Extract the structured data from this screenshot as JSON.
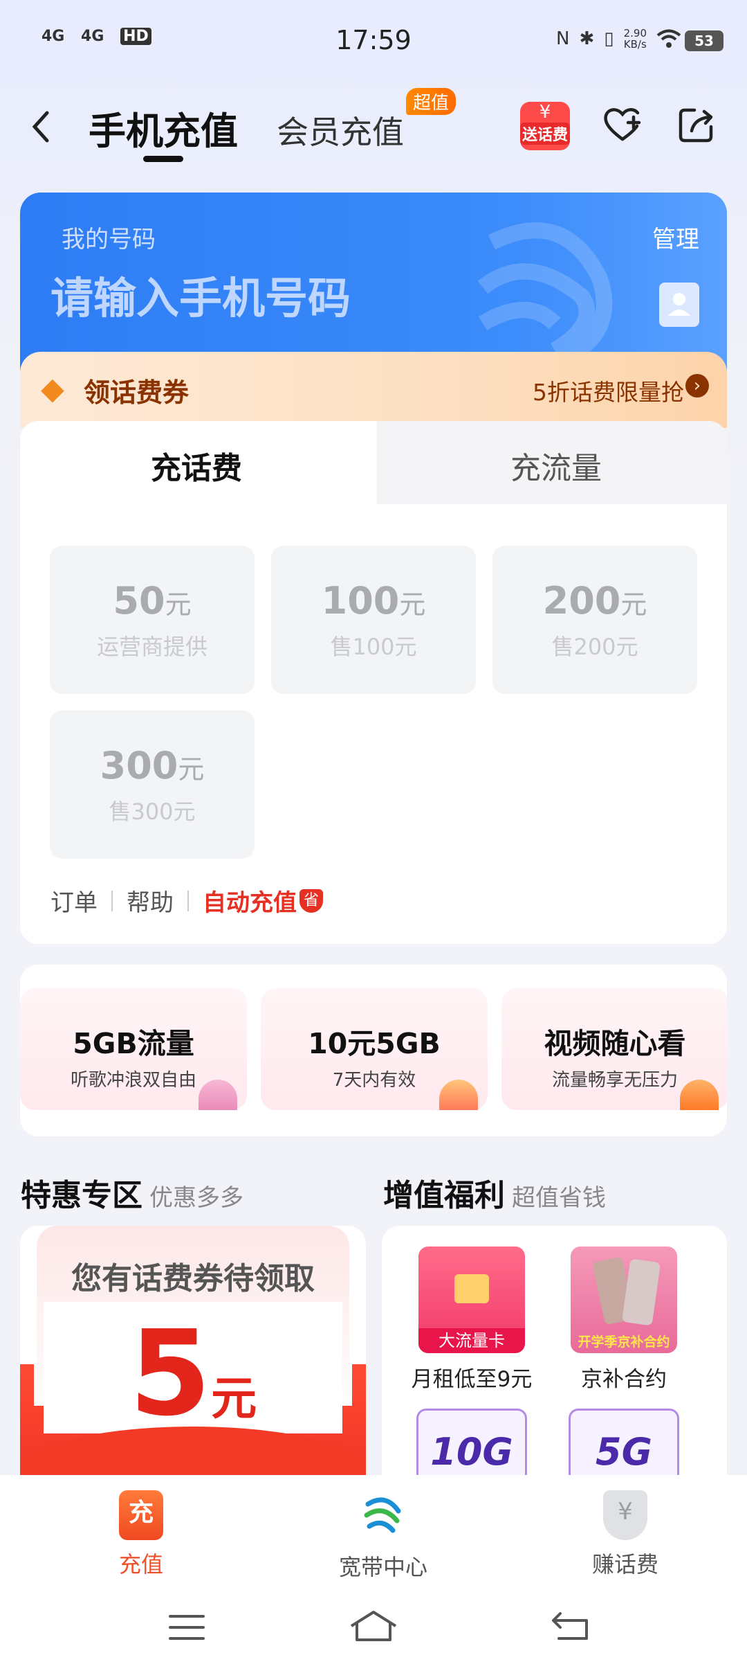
{
  "status_bar": {
    "signal_1": "4G",
    "signal_2": "4G",
    "hd": "HD",
    "time": "17:59",
    "speed_value": "2.90",
    "speed_unit": "KB/s",
    "battery": "53"
  },
  "header": {
    "tab_phone": "手机充值",
    "tab_member": "会员充值",
    "member_badge": "超值",
    "gift_label": "送话费",
    "gift_symbol": "¥"
  },
  "number_card": {
    "label": "我的号码",
    "manage": "管理",
    "placeholder": "请输入手机号码"
  },
  "coupon": {
    "title": "领话费券",
    "link": "5折话费限量抢"
  },
  "recharge": {
    "tabs": [
      "充话费",
      "充流量"
    ],
    "unit": "元",
    "amounts": [
      {
        "value": "50",
        "sub": "运营商提供"
      },
      {
        "value": "100",
        "sub": "售100元"
      },
      {
        "value": "200",
        "sub": "售200元"
      },
      {
        "value": "300",
        "sub": "售300元"
      }
    ],
    "links": {
      "order": "订单",
      "help": "帮助",
      "auto": "自动充值",
      "save_badge": "省"
    }
  },
  "promos": [
    {
      "title": "5GB流量",
      "sub": "听歌冲浪双自由"
    },
    {
      "title": "10元5GB",
      "sub": "7天内有效"
    },
    {
      "title": "视频随心看",
      "sub": "流量畅享无压力"
    }
  ],
  "special": {
    "title": "特惠专区",
    "sub": "优惠多多",
    "envelope_title": "您有话费券待领取",
    "envelope_amount": "5",
    "envelope_unit": "元"
  },
  "benefits": {
    "title": "增值福利",
    "sub": "超值省钱",
    "items": [
      {
        "label": "月租低至9元",
        "img_text": "大流量卡"
      },
      {
        "label": "京补合约",
        "img_text": "开学季京补合约"
      },
      {
        "label": "",
        "img_text": "10G"
      },
      {
        "label": "",
        "img_text": "5G"
      }
    ]
  },
  "bottom_nav": [
    {
      "label": "充值",
      "icon_text": "充"
    },
    {
      "label": "宽带中心"
    },
    {
      "label": "赚话费",
      "icon_text": "¥"
    }
  ],
  "colors": {
    "brand_blue": "#2d7cf4",
    "accent_orange": "#f0512a",
    "red": "#e53023"
  }
}
